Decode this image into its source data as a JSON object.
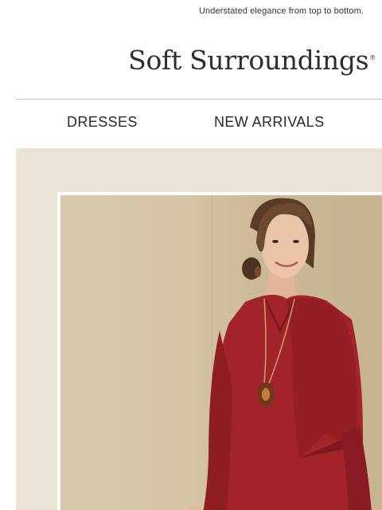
{
  "preheader": {
    "text": "Understated elegance from top to bottom."
  },
  "brand": {
    "name": "Soft Surroundings",
    "mark": "®"
  },
  "nav": {
    "items": [
      {
        "label": "DRESSES"
      },
      {
        "label": "NEW ARRIVALS"
      }
    ]
  },
  "hero": {
    "image_alt": "Woman wearing a red asymmetric poncho tunic with a pendant necklace",
    "colors": {
      "background": "#ebe3d5",
      "garment": "#a3232a"
    }
  }
}
